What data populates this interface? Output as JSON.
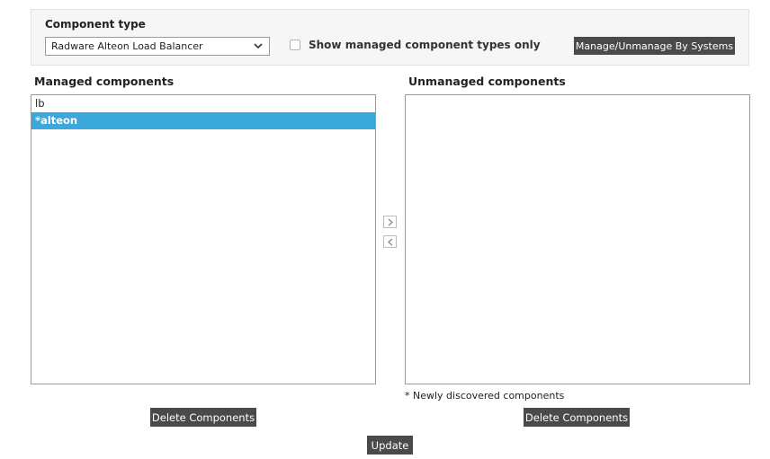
{
  "filter": {
    "component_type_label": "Component type",
    "component_type_value": "Radware Alteon Load Balancer",
    "show_managed_only_label": "Show managed component types only",
    "show_managed_only_checked": false,
    "manage_by_systems_label": "Manage/Unmanage By Systems"
  },
  "managed": {
    "title": "Managed components",
    "items": [
      "lb",
      "*alteon"
    ],
    "selected_index": 1
  },
  "unmanaged": {
    "title": "Unmanaged components",
    "items": [],
    "note": "* Newly discovered components"
  },
  "actions": {
    "delete_left_label": "Delete Components",
    "delete_right_label": "Delete Components",
    "update_label": "Update"
  },
  "icons": {
    "move_right": "chevron-right-icon",
    "move_left": "chevron-left-icon",
    "dropdown": "chevron-down-icon"
  },
  "colors": {
    "selected_row": "#3aa8da",
    "button_bg": "#4a4a4a"
  }
}
